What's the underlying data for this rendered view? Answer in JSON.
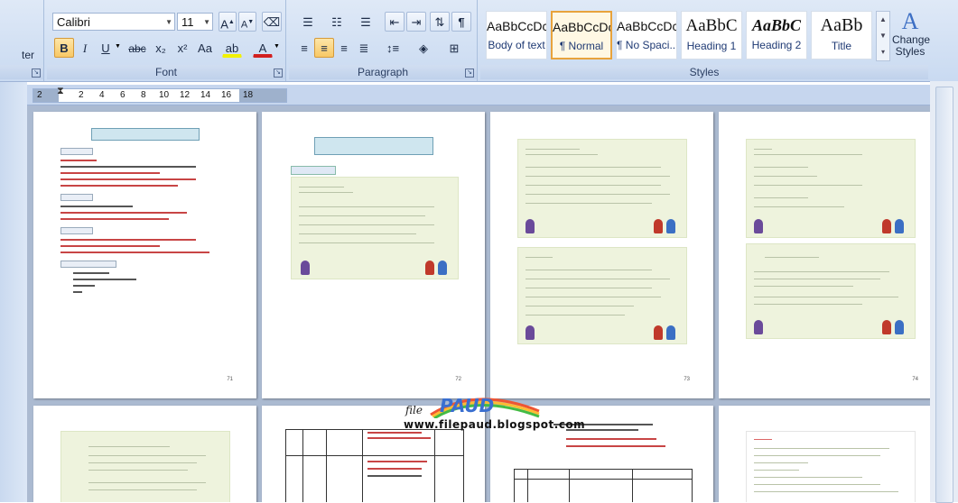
{
  "ribbon": {
    "font_group": {
      "label": "Font",
      "font_name": "Calibri",
      "font_size": "11",
      "grow_label": "A",
      "shrink_label": "A",
      "bold": "B",
      "italic": "I",
      "underline": "U",
      "strike": "abc",
      "subscript": "x₂",
      "superscript": "x²",
      "change_case": "Aa",
      "highlight": "ab",
      "font_color": "A"
    },
    "paragraph_group": {
      "label": "Paragraph"
    },
    "styles_group": {
      "label": "Styles",
      "tiles": [
        {
          "sample": "AaBbCcDc",
          "name": "Body of text"
        },
        {
          "sample": "AaBbCcDc",
          "name": "¶ Normal"
        },
        {
          "sample": "AaBbCcDc",
          "name": "¶ No Spaci..."
        },
        {
          "sample": "AaBbC",
          "name": "Heading 1"
        },
        {
          "sample": "AaBbC",
          "name": "Heading 2"
        },
        {
          "sample": "AaBb",
          "name": "Title"
        }
      ],
      "change_styles": "Change Styles"
    },
    "clipboard_partial": "ter"
  },
  "ruler": {
    "ticks": [
      "2",
      "2",
      "4",
      "6",
      "8",
      "10",
      "12",
      "14",
      "16",
      "18"
    ]
  },
  "watermark": {
    "brand": "PAUD",
    "file": "file",
    "url": "www.filepaud.blogspot.com"
  },
  "pages": {
    "p1_num": "71",
    "p2_num": "72",
    "p3_num": "73",
    "p4_num": "74"
  },
  "colors": {
    "accent": "#e8a33c",
    "ribbon": "#c9daf1"
  }
}
